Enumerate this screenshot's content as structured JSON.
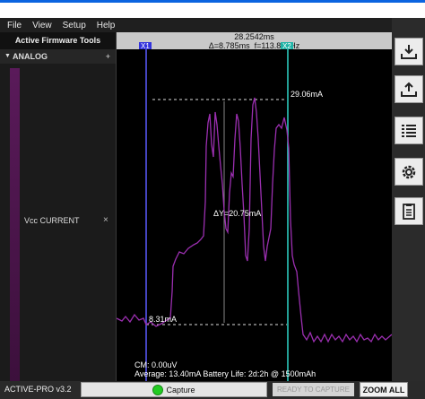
{
  "menu": [
    "File",
    "View",
    "Setup",
    "Help"
  ],
  "sidebar": {
    "title": "Active Firmware Tools",
    "section": "ANALOG",
    "plus": "+",
    "channel": "Vcc CURRENT",
    "close": "×"
  },
  "timebar": {
    "time": "28.2542ms",
    "delta": "Δ=8.785ms",
    "freq": "f=113.830Hz",
    "x1": "X1",
    "x2": "X2"
  },
  "plot": {
    "max_label": "29.06mA",
    "min_label": "8.31mA",
    "delta_y": "ΔY=20.75mA",
    "cm": "CM: 0.00uV",
    "stats": "Average: 13.40mA  Battery Life: 2d:2h @ 1500mAh",
    "trace_color": "#9b2fb0",
    "x1_color": "#5a5aff",
    "x2_color": "#2fd6c8"
  },
  "toolbar": {
    "icons": [
      "download-icon",
      "upload-icon",
      "list-icon",
      "gear-icon",
      "clipboard-icon"
    ]
  },
  "status": {
    "version": "ACTIVE-PRO v3.2",
    "capture": "Capture",
    "ready": "READY TO CAPTURE",
    "zoom": "ZOOM ALL"
  }
}
